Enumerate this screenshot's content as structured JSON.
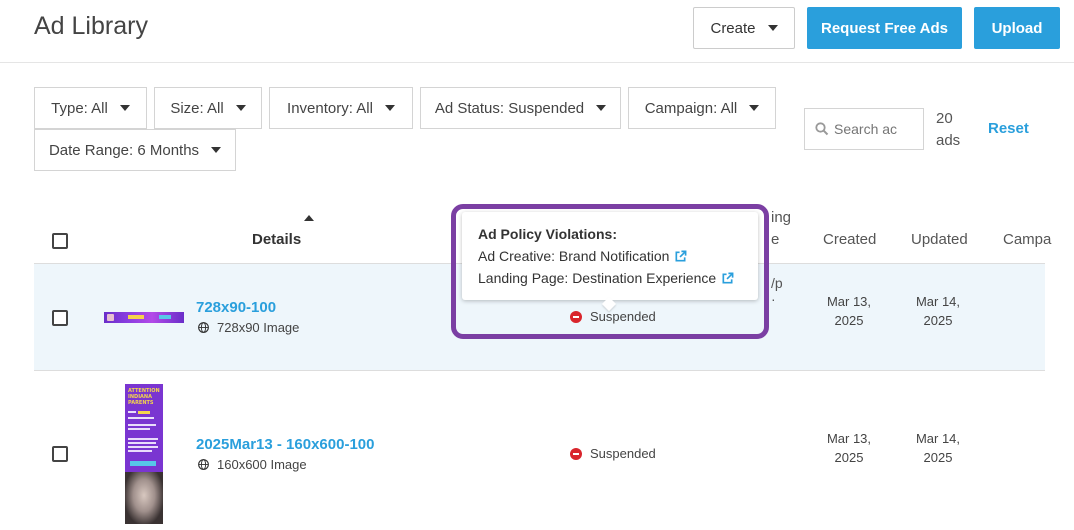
{
  "header": {
    "title": "Ad Library",
    "create_label": "Create",
    "request_label": "Request Free Ads",
    "upload_label": "Upload"
  },
  "filters": {
    "type": "Type: All",
    "size": "Size: All",
    "inventory": "Inventory: All",
    "ad_status": "Ad Status: Suspended",
    "campaign": "Campaign: All",
    "date_range": "Date Range: 6 Months",
    "search_placeholder": "Search ac",
    "count_number": "20",
    "count_unit": "ads",
    "reset_label": "Reset"
  },
  "table": {
    "headers": {
      "details": "Details",
      "created": "Created",
      "updated": "Updated",
      "campaign": "Campa",
      "partial_top": "ing",
      "partial_bottom": "e"
    },
    "rows": [
      {
        "name": "728x90-100",
        "type": "728x90 Image",
        "status": "Suspended",
        "partial_top": "/p",
        "partial_bottom": "·",
        "created_line1": "Mar 13,",
        "created_line2": "2025",
        "updated_line1": "Mar 14,",
        "updated_line2": "2025"
      },
      {
        "name": "2025Mar13 - 160x600-100",
        "type": "160x600 Image",
        "status": "Suspended",
        "created_line1": "Mar 13,",
        "created_line2": "2025",
        "updated_line1": "Mar 14,",
        "updated_line2": "2025"
      }
    ]
  },
  "popup": {
    "title": "Ad Policy Violations:",
    "line1": "Ad Creative: Brand Notification",
    "line2": "Landing Page: Destination Experience"
  },
  "thumbnail": {
    "lines": [
      "ATTENTION",
      "INDIANA",
      "PARENTS"
    ]
  },
  "colors": {
    "primary": "#2a9fdc",
    "suspended": "#d9252c",
    "highlight": "#7b3fa3",
    "row_selected": "#eef6fb"
  }
}
